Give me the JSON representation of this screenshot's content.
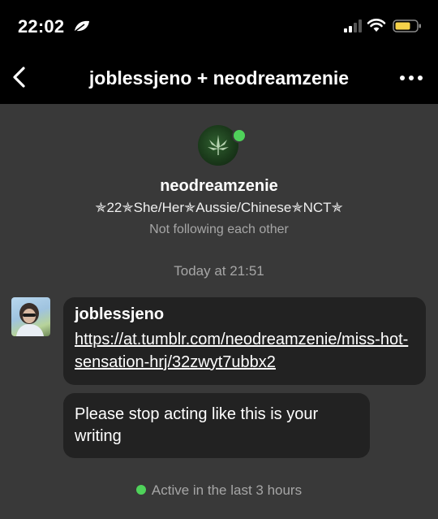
{
  "status_bar": {
    "time": "22:02",
    "icons": [
      "leaf-icon",
      "cellular-signal-icon",
      "wifi-icon",
      "battery-icon"
    ]
  },
  "nav": {
    "title": "joblessjeno + neodreamzenie",
    "back_icon": "chevron-left-icon",
    "more_icon": "more-horizontal-icon"
  },
  "profile": {
    "name": "neodreamzenie",
    "bio": "✯22✯She/Her✯Aussie/Chinese✯NCT✯",
    "follow_status": "Not following each other",
    "online": true
  },
  "conversation": {
    "timestamp": "Today at 21:51",
    "messages": [
      {
        "sender": "joblessjeno",
        "link": "https://at.tumblr.com/neodreamzenie/miss-hot-sensation-hrj/32zwyt7ubbx2"
      },
      {
        "text": "Please stop acting like this is your writing"
      }
    ],
    "active_status": "Active in the last 3 hours"
  },
  "colors": {
    "background": "#393939",
    "bar_background": "#000000",
    "bubble": "#222222",
    "online_green": "#4fd25a",
    "muted_text": "#a6a6a6"
  }
}
